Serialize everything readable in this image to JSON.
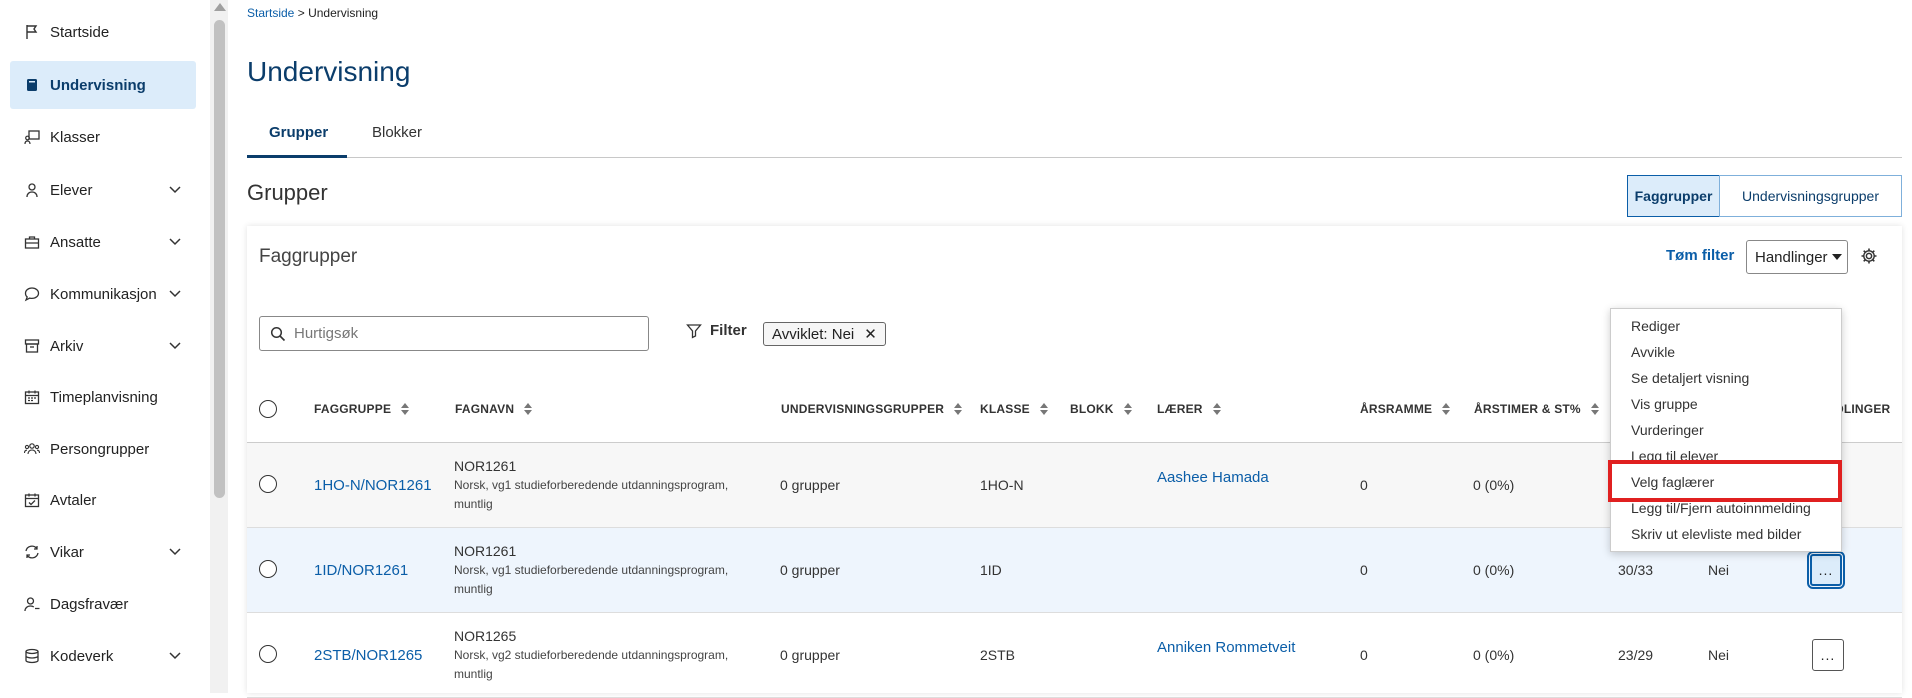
{
  "sidebar": {
    "items": [
      {
        "label": "Startside",
        "icon": "flag-icon",
        "expandable": false,
        "active": false
      },
      {
        "label": "Undervisning",
        "icon": "book-icon",
        "expandable": false,
        "active": true
      },
      {
        "label": "Klasser",
        "icon": "classroom-icon",
        "expandable": false,
        "active": false
      },
      {
        "label": "Elever",
        "icon": "student-icon",
        "expandable": true,
        "active": false
      },
      {
        "label": "Ansatte",
        "icon": "briefcase-icon",
        "expandable": true,
        "active": false
      },
      {
        "label": "Kommunikasjon",
        "icon": "chat-icon",
        "expandable": true,
        "active": false
      },
      {
        "label": "Arkiv",
        "icon": "archive-icon",
        "expandable": true,
        "active": false
      },
      {
        "label": "Timeplanvisning",
        "icon": "calendar-icon",
        "expandable": false,
        "active": false
      },
      {
        "label": "Persongrupper",
        "icon": "people-icon",
        "expandable": false,
        "active": false
      },
      {
        "label": "Avtaler",
        "icon": "calendar-check-icon",
        "expandable": false,
        "active": false
      },
      {
        "label": "Vikar",
        "icon": "swap-icon",
        "expandable": true,
        "active": false
      },
      {
        "label": "Dagsfravær",
        "icon": "person-minus-icon",
        "expandable": false,
        "active": false
      },
      {
        "label": "Kodeverk",
        "icon": "database-icon",
        "expandable": true,
        "active": false
      }
    ]
  },
  "breadcrumb": {
    "home": "Startside",
    "separator": ">",
    "current": "Undervisning"
  },
  "page": {
    "title": "Undervisning"
  },
  "tabs": [
    {
      "label": "Grupper",
      "active": true
    },
    {
      "label": "Blokker",
      "active": false
    }
  ],
  "section": {
    "title": "Grupper",
    "toggle": [
      {
        "label": "Faggrupper",
        "active": true
      },
      {
        "label": "Undervisningsgrupper",
        "active": false
      }
    ]
  },
  "card": {
    "title": "Faggrupper",
    "clear_filter": "Tøm filter",
    "actions_label": "Handlinger",
    "search_placeholder": "Hurtigsøk",
    "filter_label": "Filter",
    "chip_label": "Avviklet: Nei"
  },
  "table": {
    "columns": [
      "FAGGRUPPE",
      "FAGNAVN",
      "UNDERVISNINGSGRUPPER",
      "KLASSE",
      "BLOKK",
      "LÆRER",
      "ÅRSRAMME",
      "ÅRSTIMER & ST%",
      "DLINGER"
    ],
    "rows": [
      {
        "faggruppe": "1HO-N/NOR1261",
        "code": "NOR1261",
        "desc": "Norsk, vg1 studieforberedende utdanningsprogram, muntlig",
        "undervisningsgrupper": "0 grupper",
        "klasse": "1HO-N",
        "laerer": "Aashee Hamada",
        "arsramme": "0",
        "arstimer": "0 (0%)",
        "extra1": "",
        "extra2": ""
      },
      {
        "faggruppe": "1ID/NOR1261",
        "code": "NOR1261",
        "desc": "Norsk, vg1 studieforberedende utdanningsprogram, muntlig",
        "undervisningsgrupper": "0 grupper",
        "klasse": "1ID",
        "laerer": "",
        "arsramme": "0",
        "arstimer": "0 (0%)",
        "extra1": "30/33",
        "extra2": "Nei"
      },
      {
        "faggruppe": "2STB/NOR1265",
        "code": "NOR1265",
        "desc": "Norsk, vg2 studieforberedende utdanningsprogram, muntlig",
        "undervisningsgrupper": "0 grupper",
        "klasse": "2STB",
        "laerer": "Anniken Rommetveit",
        "arsramme": "0",
        "arstimer": "0 (0%)",
        "extra1": "23/29",
        "extra2": "Nei"
      }
    ],
    "row_menu_label": "..."
  },
  "dropdown": {
    "items": [
      "Rediger",
      "Avvikle",
      "Se detaljert visning",
      "Vis gruppe",
      "Vurderinger",
      "Legg til elever",
      "Velg faglærer",
      "Legg til/Fjern autoinnmelding",
      "Skriv ut elevliste med bilder"
    ],
    "highlighted": "Velg faglærer"
  },
  "colors": {
    "accent": "#0b5ea8",
    "active_bg": "#dcecfa",
    "highlight": "#e02020"
  }
}
